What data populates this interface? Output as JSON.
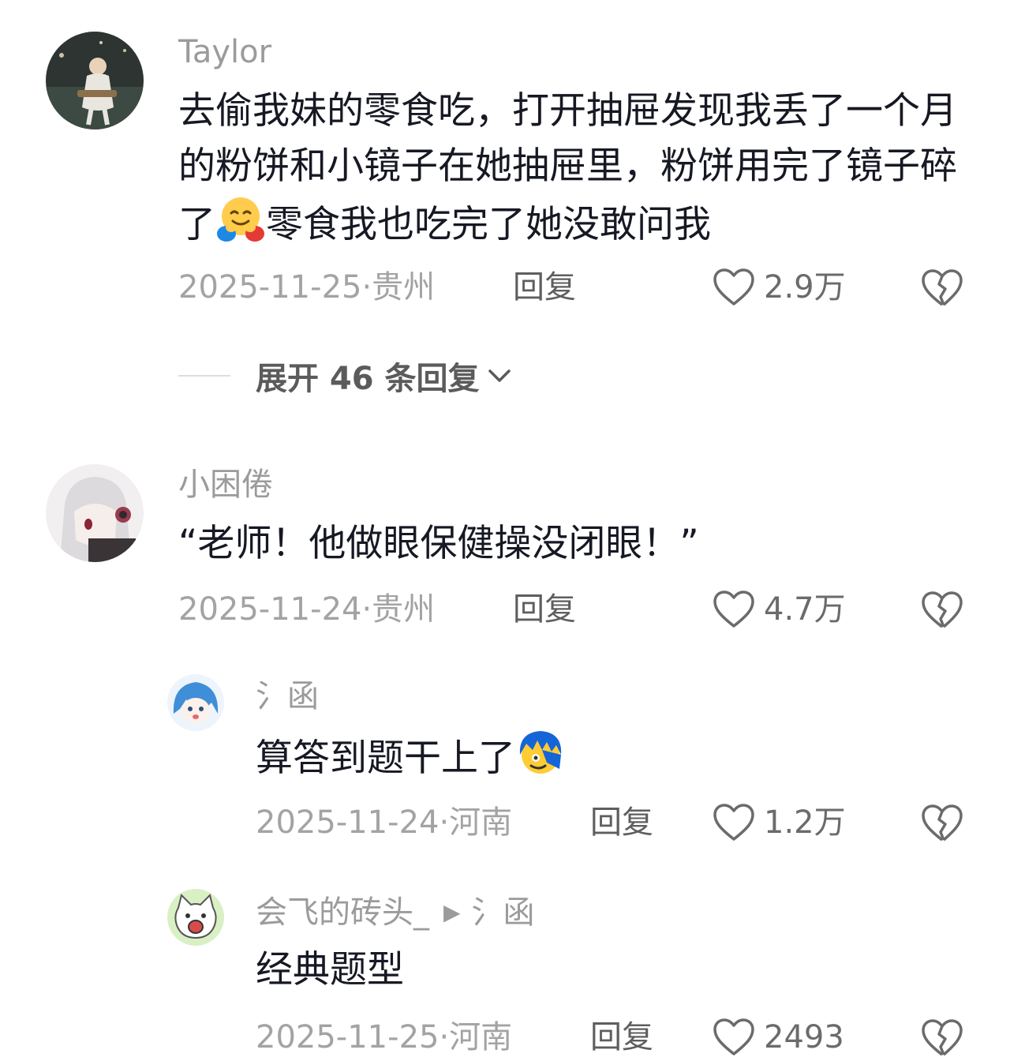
{
  "comments": [
    {
      "username": "Taylor",
      "text_before": "去偷我妹的零食吃，打开抽屉发现我丢了一个月的粉饼和小镜子在她抽屉里，粉饼用完了镜子碎了",
      "emoji": "hugging-face",
      "text_after": "零食我也吃完了她没敢问我",
      "time_location": "2025-11-25·贵州",
      "reply_label": "回复",
      "likes": "2.9万"
    },
    {
      "username": "小困倦",
      "text": "“老师！他做眼保健操没闭眼！”",
      "time_location": "2025-11-24·贵州",
      "reply_label": "回复",
      "likes": "4.7万"
    }
  ],
  "expand_replies": "展开 46 条回复",
  "replies": [
    {
      "username": "氵函",
      "text": "算答到题干上了",
      "emoji": "blue-hair-face",
      "time_location": "2025-11-24·河南",
      "reply_label": "回复",
      "likes": "1.2万"
    },
    {
      "username": "会飞的砖头_",
      "reply_to": "氵函",
      "text": "经典题型",
      "time_location": "2025-11-25·河南",
      "reply_label": "回复",
      "likes": "2493"
    }
  ],
  "colors": {
    "text": "#161823",
    "username": "#9b9b9b",
    "meta": "#a3a3a3",
    "icon": "#6b6b6b"
  }
}
